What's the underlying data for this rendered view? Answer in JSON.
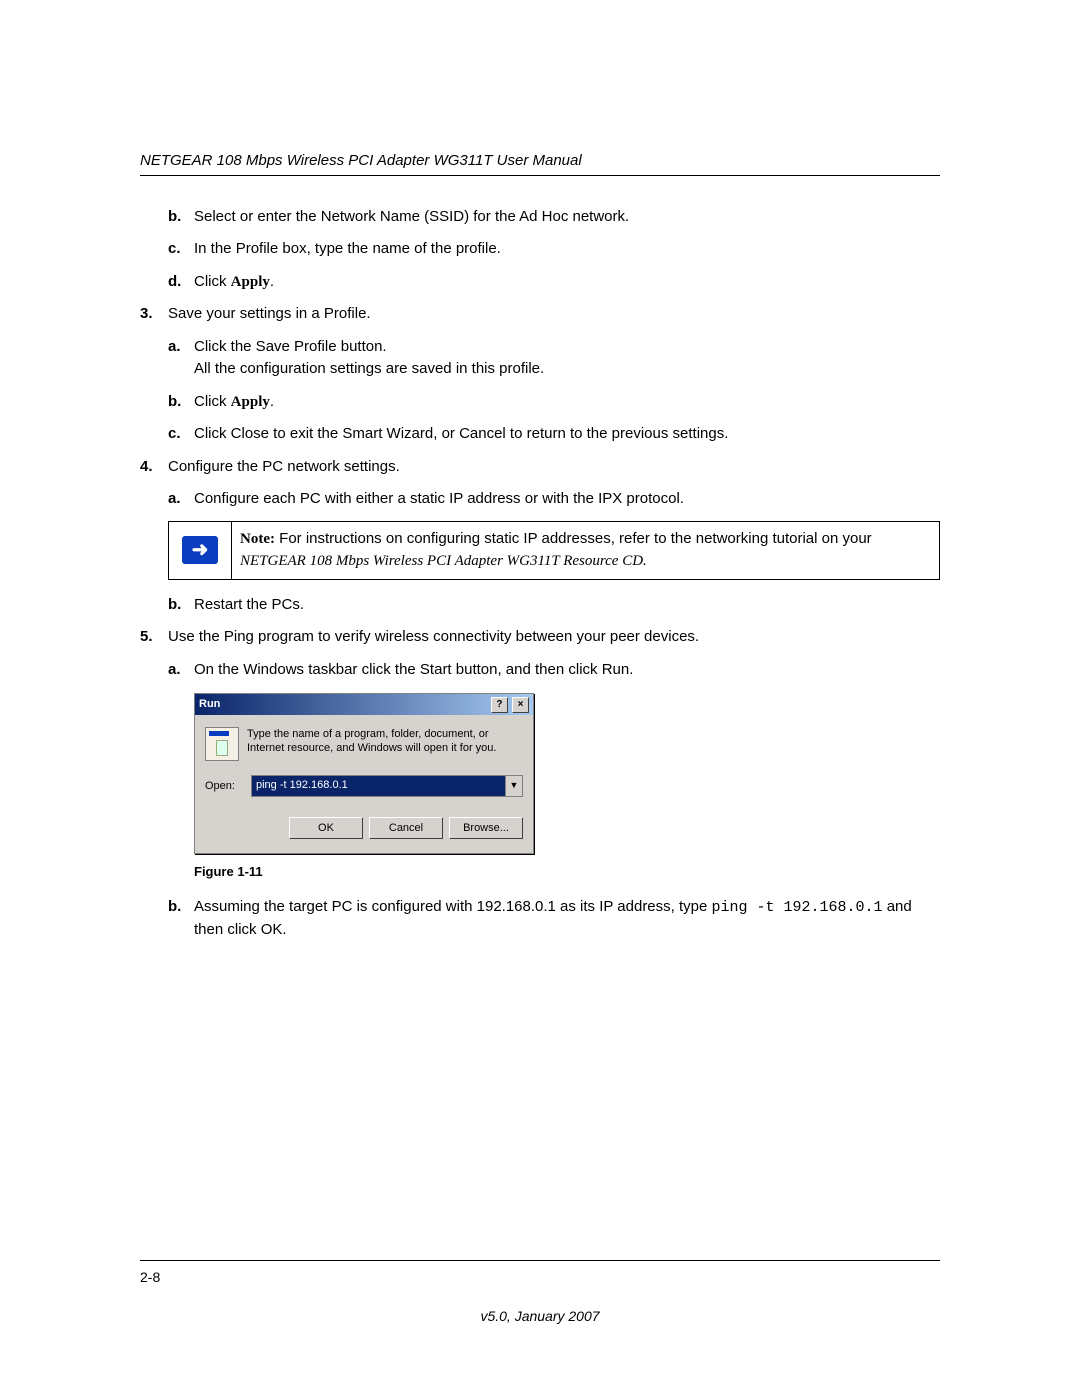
{
  "header": {
    "title": "NETGEAR 108 Mbps Wireless PCI Adapter WG311T User Manual"
  },
  "content": {
    "step_2b": "Select or enter the Network Name (SSID) for the Ad Hoc network.",
    "step_2c": "In the Profile box, type the name of the profile.",
    "step_2d_prefix": "Click ",
    "step_2d_apply": "Apply",
    "step_2d_suffix": ".",
    "step_3": "Save your settings in a Profile.",
    "step_3a_line1": "Click the Save Profile button.",
    "step_3a_line2": "All the configuration settings are saved in this profile.",
    "step_3b_prefix": "Click ",
    "step_3b_apply": "Apply",
    "step_3b_suffix": ".",
    "step_3c": "Click Close to exit the Smart Wizard, or Cancel to return to the previous settings.",
    "step_4": "Configure the PC network settings.",
    "step_4a": "Configure each PC with either a static IP address or with the IPX protocol.",
    "note_label": "Note:",
    "note_text_1": " For instructions on configuring static IP addresses, refer to the networking tutorial on your ",
    "note_cd_title": "NETGEAR 108 Mbps Wireless PCI Adapter WG311T Resource CD",
    "note_text_3": ".",
    "step_4b": "Restart the PCs.",
    "step_5": "Use the Ping program to verify wireless connectivity between your peer devices.",
    "step_5a": "On the Windows taskbar click the Start button, and then click Run.",
    "step_5b_1": "Assuming the target PC is configured with 192.168.0.1 as its IP address, type ",
    "step_5b_code": "ping -t 192.168.0.1",
    "step_5b_2": " and then click OK."
  },
  "markers": {
    "b": "b.",
    "c": "c.",
    "d": "d.",
    "a": "a.",
    "n3": "3.",
    "n4": "4.",
    "n5": "5."
  },
  "run_dialog": {
    "title": "Run",
    "help_btn": "?",
    "close_btn": "×",
    "description": "Type the name of a program, folder, document, or Internet resource, and Windows will open it for you.",
    "open_label": "Open:",
    "open_value": "ping -t 192.168.0.1",
    "dropdown_glyph": "▼",
    "ok": "OK",
    "cancel": "Cancel",
    "browse": "Browse..."
  },
  "figure_caption": "Figure 1-11",
  "arrow_glyph": "➜",
  "footer": {
    "page_num": "2-8",
    "version": "v5.0, January 2007"
  }
}
